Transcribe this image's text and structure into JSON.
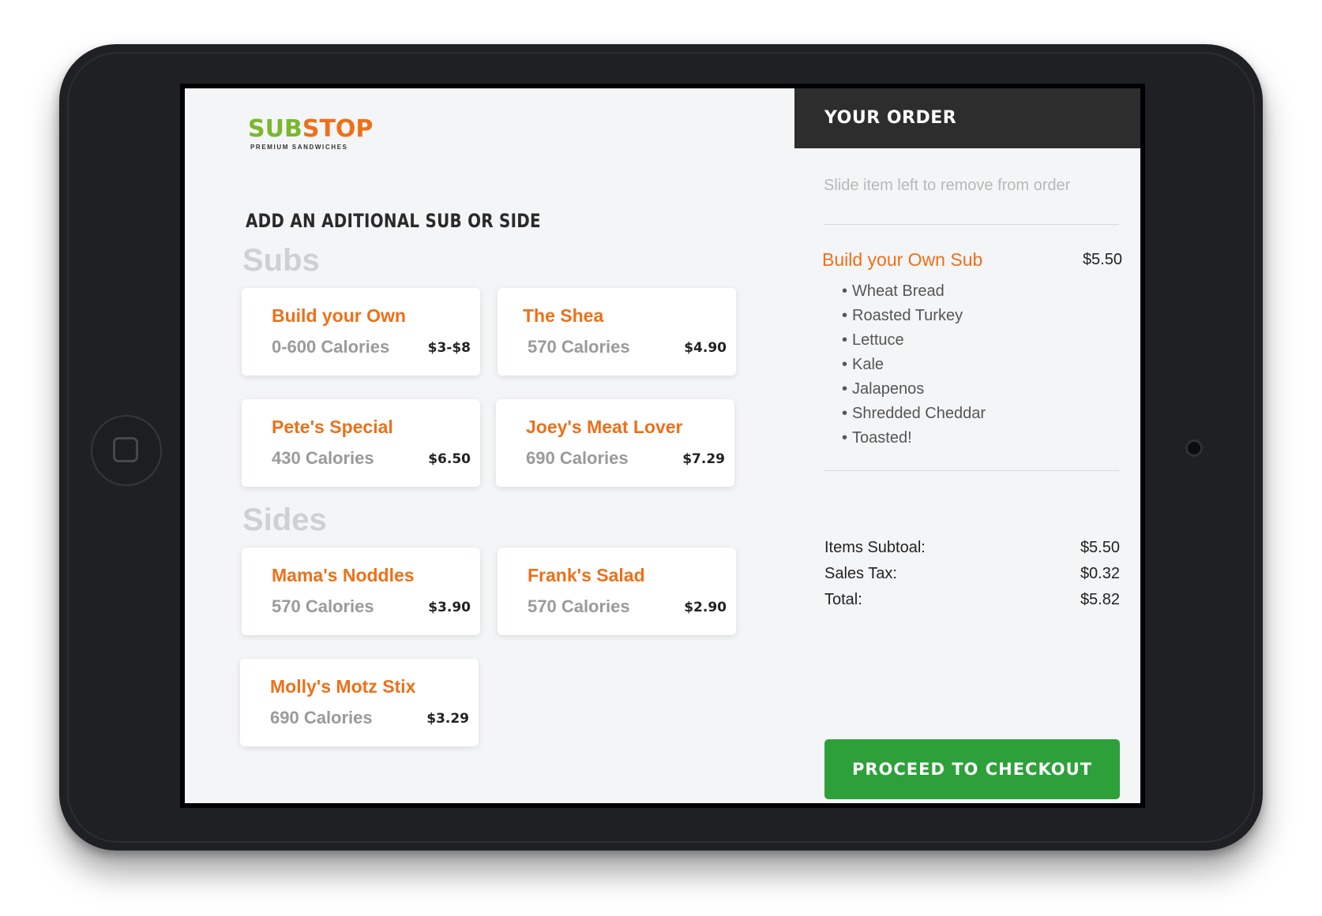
{
  "brand": {
    "logo_part1": "SUB",
    "logo_part2": "STOP",
    "tagline": "PREMIUM SANDWICHES"
  },
  "menu": {
    "heading": "ADD AN ADITIONAL SUB OR SIDE",
    "subs_title": "Subs",
    "sides_title": "Sides",
    "subs": [
      {
        "name": "Build your Own",
        "calories": "0-600 Calories",
        "price": "$3-$8"
      },
      {
        "name": "The Shea",
        "calories": "570 Calories",
        "price": "$4.90"
      },
      {
        "name": "Pete's Special",
        "calories": "430 Calories",
        "price": "$6.50"
      },
      {
        "name": "Joey's Meat Lover",
        "calories": "690 Calories",
        "price": "$7.29"
      }
    ],
    "sides": [
      {
        "name": "Mama's Noddles",
        "calories": "570 Calories",
        "price": "$3.90"
      },
      {
        "name": "Frank's Salad",
        "calories": "570 Calories",
        "price": "$2.90"
      },
      {
        "name": "Molly's Motz Stix",
        "calories": "690 Calories",
        "price": "$3.29"
      }
    ]
  },
  "order": {
    "title": "YOUR ORDER",
    "hint": "Slide item left to remove from order",
    "item": {
      "name": "Build your Own Sub",
      "price": "$5.50",
      "ingredients": [
        "Wheat Bread",
        "Roasted Turkey",
        "Lettuce",
        "Kale",
        "Jalapenos",
        "Shredded Cheddar",
        "Toasted!"
      ]
    },
    "totals": [
      {
        "label": "Items Subtoal:",
        "value": "$5.50"
      },
      {
        "label": "Sales Tax:",
        "value": "$0.32"
      },
      {
        "label": "Total:",
        "value": "$5.82"
      }
    ],
    "checkout_label": "PROCEED TO CHECKOUT"
  },
  "colors": {
    "accent_orange": "#ed7019",
    "brand_green": "#7ab72d",
    "checkout_green": "#2da03a",
    "header_dark": "#2d2d2d"
  }
}
